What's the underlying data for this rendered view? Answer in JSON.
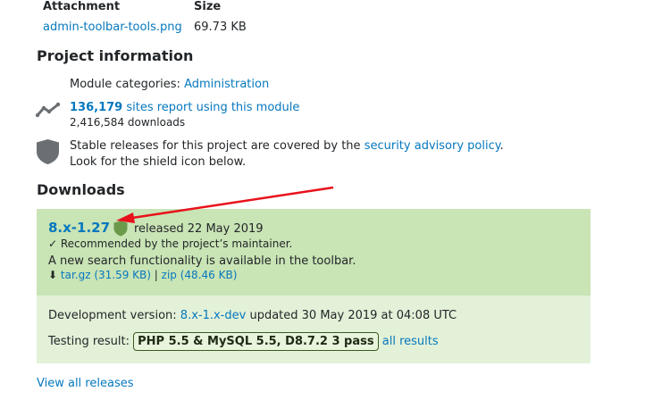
{
  "attachment": {
    "col_attachment": "Attachment",
    "col_size": "Size",
    "file_name": "admin-toolbar-tools.png",
    "file_size": "69.73 KB"
  },
  "project_info": {
    "heading": "Project information",
    "module_categories_label": "Module categories:",
    "module_categories_value": "Administration",
    "sites_count": "136,179",
    "sites_text": "sites report using this module",
    "downloads_count": "2,416,584 downloads",
    "security_text_1": "Stable releases for this project are covered by the",
    "security_link": "security advisory policy",
    "security_text_1_end": ".",
    "security_text_2": "Look for the shield icon below."
  },
  "downloads": {
    "heading": "Downloads",
    "release": {
      "version": "8.x-1.27",
      "released": "released 22 May 2019",
      "recommended": "✓ Recommended by the project’s maintainer.",
      "description": "A new search functionality is available in the toolbar.",
      "download_arrow": "⬇",
      "targz": "tar.gz (31.59 KB)",
      "separator": "|",
      "zip": "zip (48.46 KB)"
    },
    "dev": {
      "label": "Development version:",
      "version": "8.x-1.x-dev",
      "updated": "updated 30 May 2019 at 04:08 UTC"
    },
    "testing": {
      "label": "Testing result:",
      "result": "PHP 5.5 & MySQL 5.5, D8.7.2 3 pass",
      "all_results": "all results"
    },
    "view_all": "View all releases"
  },
  "colors": {
    "link": "#0678be",
    "release_bg": "#c9e4b5",
    "dev_bg": "#e3f1d8",
    "shield_gray": "#6b6f73",
    "shield_green": "#6a9a4a",
    "annotation_arrow": "#e8121b"
  }
}
